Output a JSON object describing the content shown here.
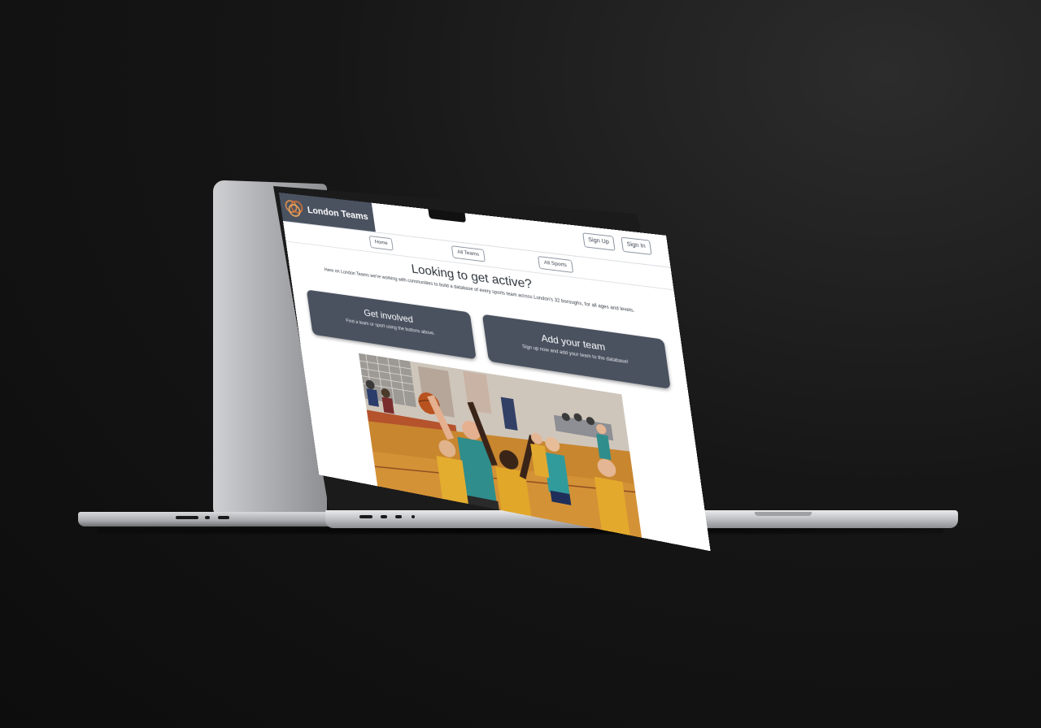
{
  "site": {
    "brand_name": "London Teams",
    "auth": {
      "signup_label": "Sign Up",
      "signin_label": "Sign In"
    },
    "nav": [
      {
        "label": "Home"
      },
      {
        "label": "All Teams"
      },
      {
        "label": "All Sports"
      }
    ],
    "hero": {
      "title": "Looking to get active?",
      "text": "Here on London Teams we're working with communities to build a database of every sports team across London's 32 boroughs, for all ages and levels."
    },
    "cards": [
      {
        "title": "Get involved",
        "subtitle": "Find a team or sport using the buttons above."
      },
      {
        "title": "Add your team",
        "subtitle": "Sign up now and add your team to the database!"
      }
    ],
    "photo": {
      "icon": "basketball-photo"
    }
  },
  "colors": {
    "brand_bg": "#4a5260",
    "page_bg": "#ffffff",
    "background": "#111111"
  }
}
